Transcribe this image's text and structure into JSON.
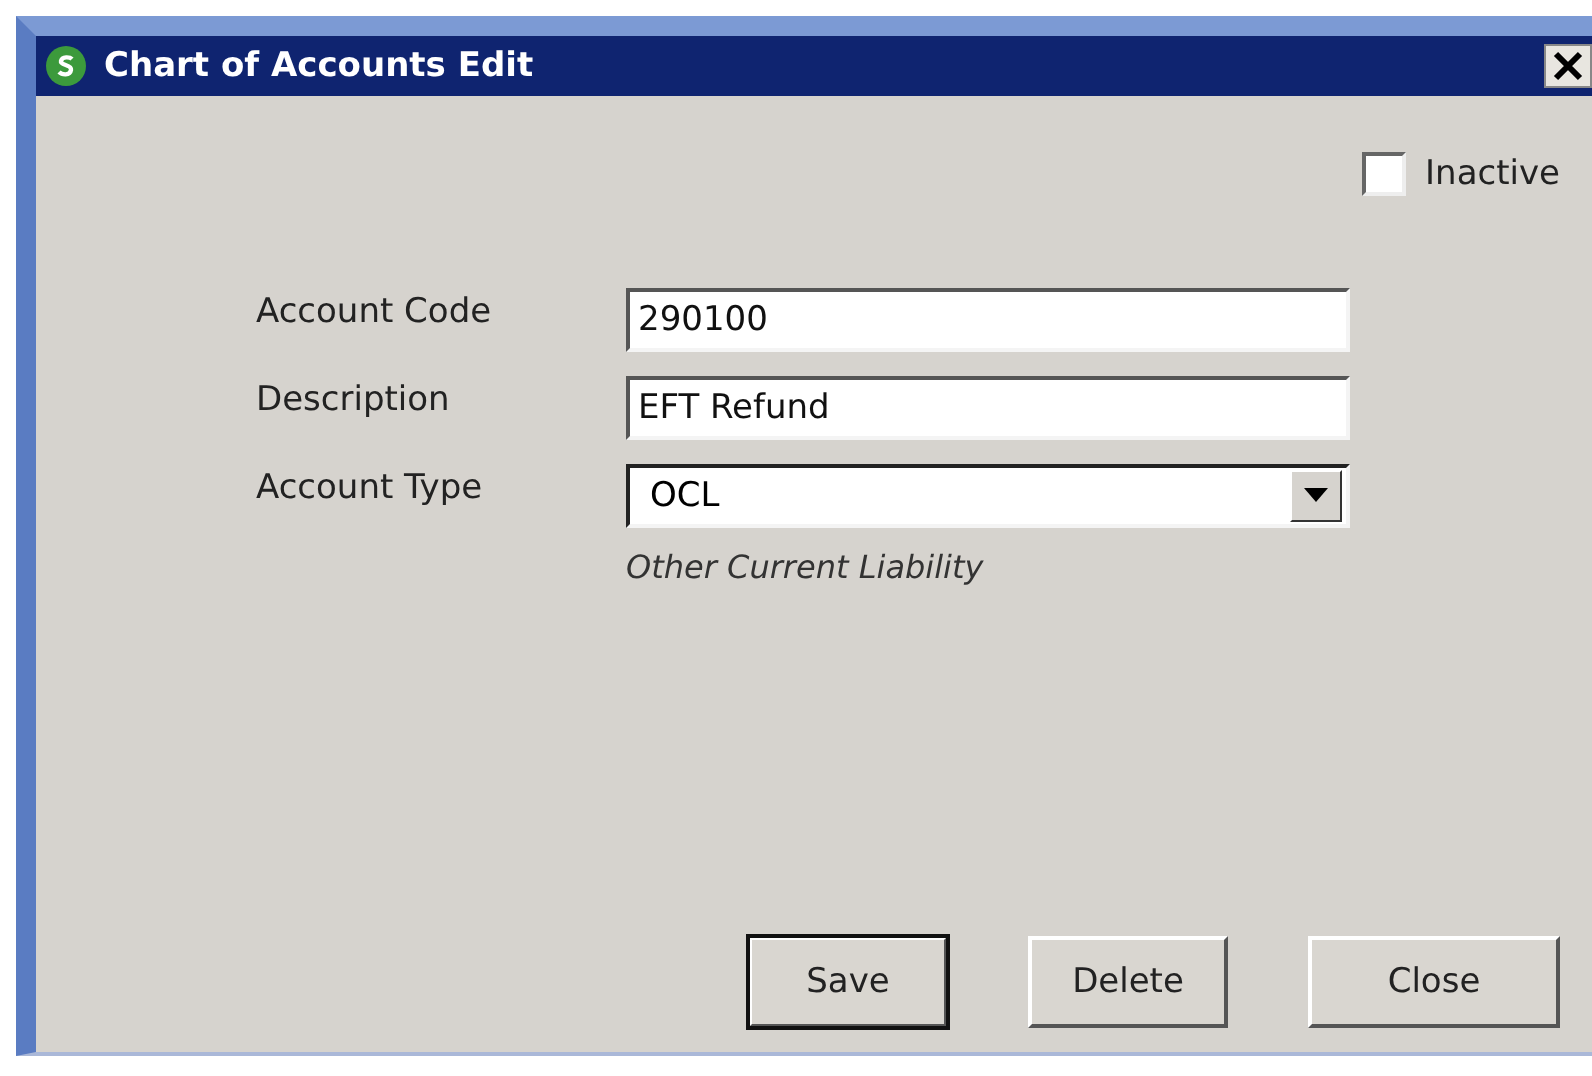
{
  "window": {
    "title": "Chart of Accounts Edit"
  },
  "inactive": {
    "label": "Inactive",
    "checked": false
  },
  "fields": [
    {
      "kind": "text",
      "label": "Account Code",
      "value": "290100"
    },
    {
      "kind": "text",
      "label": "Description",
      "value": "EFT Refund"
    },
    {
      "kind": "dropdown",
      "label": "Account Type",
      "value": "OCL",
      "hint": "Other Current Liability"
    }
  ],
  "buttons": [
    {
      "label": "Save",
      "default": true
    },
    {
      "label": "Delete",
      "default": false
    },
    {
      "label": "Close",
      "default": false
    }
  ]
}
